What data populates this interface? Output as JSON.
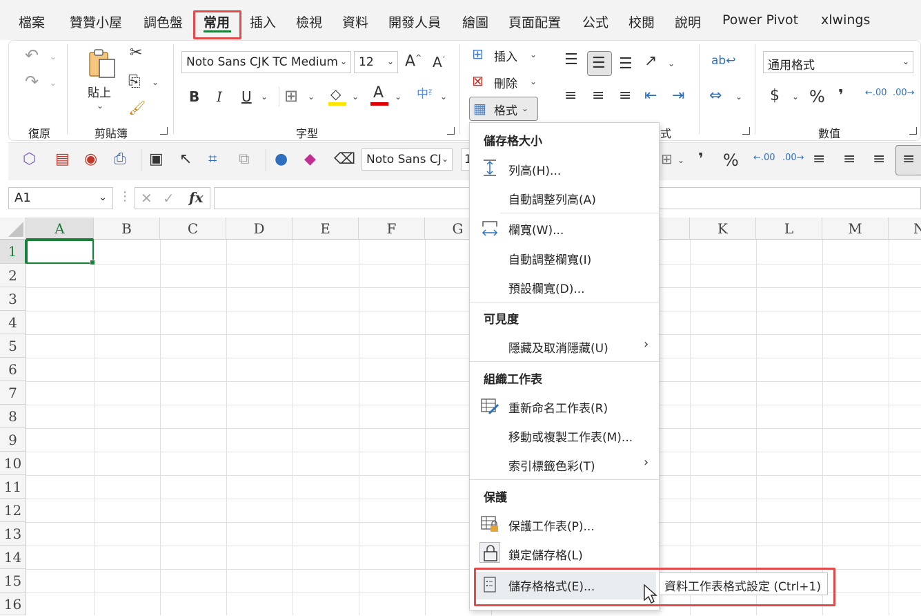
{
  "menubar": {
    "tabs": [
      "檔案",
      "贊贊小屋",
      "調色盤",
      "常用",
      "插入",
      "檢視",
      "資料",
      "開發人員",
      "繪圖",
      "頁面配置",
      "公式",
      "校閱",
      "說明",
      "Power Pivot",
      "xlwings"
    ],
    "active_tab": "常用"
  },
  "ribbon": {
    "undo_group": "復原",
    "clipboard_group": "剪貼簿",
    "paste_label": "貼上",
    "font_group": "字型",
    "font_name": "Noto Sans CJK TC Medium",
    "font_size": "12",
    "cells": {
      "insert_label": "插入",
      "delete_label": "刪除",
      "format_label": "格式"
    },
    "alignment_group_partial": "式",
    "number_group": "數值",
    "number_format": "通用格式",
    "currency_symbol": "$",
    "percent_symbol": "%",
    "comma_symbol": "❜",
    "inc_decimal": ".00",
    "dec_decimal": ".00"
  },
  "qat": {
    "font_name": "Noto Sans CJ",
    "font_size_partial": "1",
    "percent_symbol": "%",
    "comma_symbol": "❜"
  },
  "formula_bar": {
    "name_box": "A1",
    "fx": "fx",
    "content": ""
  },
  "grid": {
    "columns": [
      "A",
      "B",
      "C",
      "D",
      "E",
      "F",
      "G",
      "K",
      "L",
      "M",
      "N"
    ],
    "rows": [
      "1",
      "2",
      "3",
      "4",
      "5",
      "6",
      "7",
      "8",
      "9",
      "10",
      "11",
      "12",
      "13",
      "14",
      "15",
      "16"
    ],
    "active_cell": "A1"
  },
  "format_menu": {
    "section_cell_size": "儲存格大小",
    "row_height": "列高(H)...",
    "autofit_row": "自動調整列高(A)",
    "col_width": "欄寬(W)...",
    "autofit_col": "自動調整欄寬(I)",
    "default_width": "預設欄寬(D)...",
    "section_visibility": "可見度",
    "hide_unhide": "隱藏及取消隱藏(U)",
    "section_organize": "組織工作表",
    "rename_sheet": "重新命名工作表(R)",
    "move_copy": "移動或複製工作表(M)...",
    "tab_color": "索引標籤色彩(T)",
    "section_protection": "保護",
    "protect_sheet": "保護工作表(P)...",
    "lock_cell": "鎖定儲存格(L)",
    "format_cells": "儲存格格式(E)..."
  },
  "tooltip": "資料工作表格式設定 (Ctrl+1)",
  "colors": {
    "accent_green": "#1a7f37",
    "highlight_red": "#e04c4c",
    "font_color_red": "#e00000",
    "fill_yellow": "#ffe600"
  }
}
